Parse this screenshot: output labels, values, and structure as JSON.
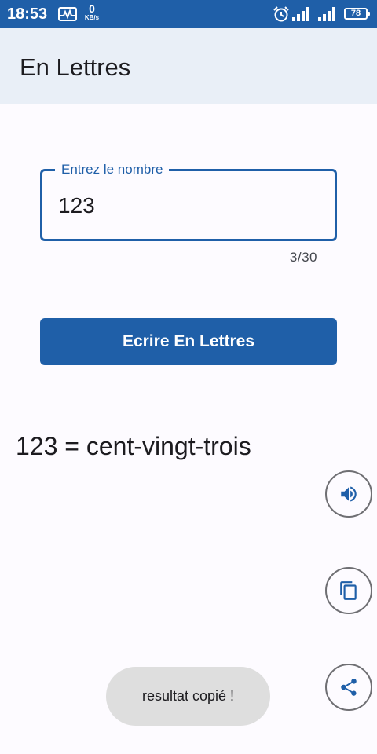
{
  "status_bar": {
    "time": "18:53",
    "network_speed_value": "0",
    "network_speed_unit": "KB/s",
    "battery_level": "78",
    "background_color": "#1f5fa8"
  },
  "app_bar": {
    "title": "En Lettres",
    "background_color": "#e9eff7"
  },
  "number_field": {
    "label": "Entrez le nombre",
    "value": "123",
    "counter": "3/30",
    "accent_color": "#1f5fa8"
  },
  "convert_button": {
    "label": "Ecrire En Lettres"
  },
  "result": {
    "text": "123 = cent-vingt-trois"
  },
  "actions": {
    "speak_icon": "volume-up-icon",
    "copy_icon": "copy-icon",
    "share_icon": "share-icon"
  },
  "toast": {
    "message": "resultat copié !"
  }
}
